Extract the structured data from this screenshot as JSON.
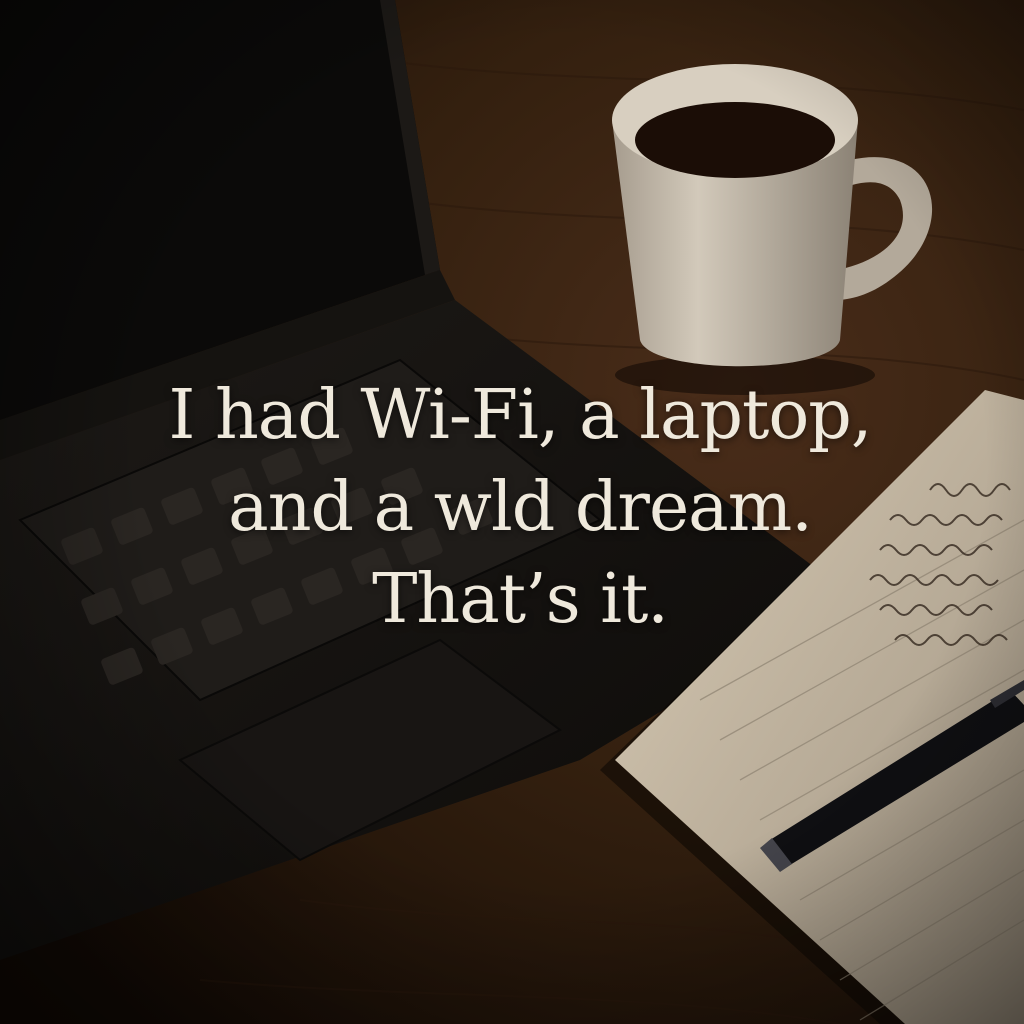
{
  "quote": {
    "lines": [
      "I had Wi-Fi, a laptop,",
      "and a wld dream.",
      "That’s it."
    ],
    "text_color": "#efe9dc"
  },
  "scene": {
    "objects": [
      "laptop",
      "coffee-mug",
      "notebook",
      "pen",
      "wooden-desk"
    ],
    "palette": {
      "desk": "#3a2214",
      "laptop": "#141210",
      "mug": "#c9bfb0",
      "coffee": "#1b0d06",
      "paper": "#cdbfa8",
      "pen": "#0e0e10"
    }
  }
}
